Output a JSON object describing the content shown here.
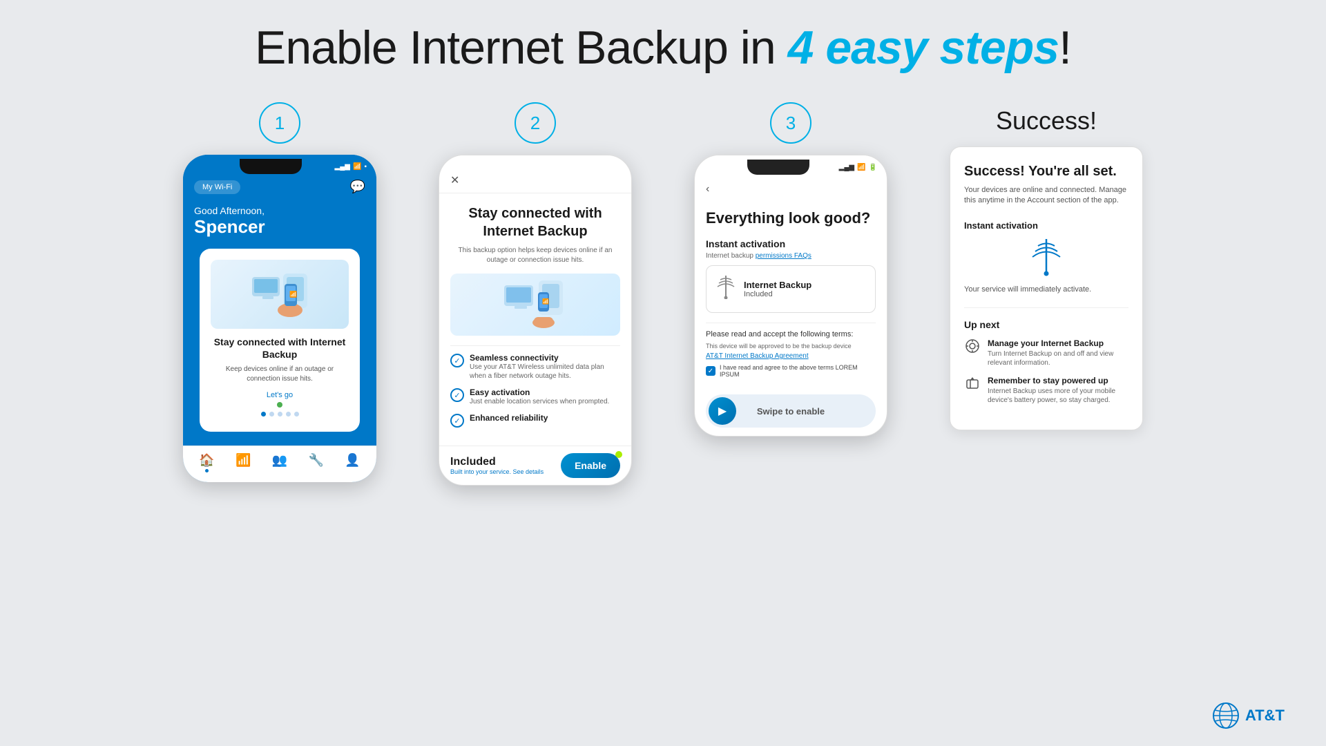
{
  "page": {
    "title_prefix": "Enable Internet Backup in ",
    "title_highlight": "4 easy steps",
    "title_suffix": "!"
  },
  "step1": {
    "number": "1",
    "status_signal": "▂▄▆",
    "status_wifi": "WiFi",
    "status_battery": "🔋",
    "wifi_pill": "My Wi-Fi",
    "greeting": "Good Afternoon,",
    "name": "Spencer",
    "card_title": "Stay connected with Internet Backup",
    "card_desc": "Keep devices online if an outage or connection issue hits.",
    "lets_go": "Let's go",
    "nav_items": [
      "home",
      "wifi",
      "people",
      "tools",
      "person"
    ]
  },
  "step2": {
    "number": "2",
    "title": "Stay connected with Internet Backup",
    "subtitle": "This backup option helps keep devices online if an outage or connection issue hits.",
    "feature1_title": "Seamless connectivity",
    "feature1_desc": "Use your AT&T Wireless unlimited data plan when a fiber network outage hits.",
    "feature2_title": "Easy activation",
    "feature2_desc": "Just enable location services when prompted.",
    "feature3_title": "Enhanced reliability",
    "included_label": "Included",
    "included_sub": "Built into your service. See details",
    "enable_btn": "Enable"
  },
  "step3": {
    "number": "3",
    "title": "Everything look good?",
    "activation_label": "Instant activation",
    "activation_sub": "Internet backup permissions FAQs",
    "backup_title": "Internet Backup",
    "backup_included": "Included",
    "terms_label": "Please read and accept the following terms:",
    "terms_desc": "This device will be approved to be the backup device",
    "terms_link": "AT&T Internet Backup Agreement",
    "terms_agree": "I have read and agree to the above terms LOREM IPSUM",
    "swipe_label": "Swipe to enable"
  },
  "success": {
    "label": "Success!",
    "title": "Success! You're all set.",
    "desc": "Your devices are online and connected. Manage this anytime in the Account section of the app.",
    "activation_label": "Instant activation",
    "activation_desc": "Your service will immediately activate.",
    "up_next_label": "Up next",
    "item1_title": "Manage your Internet Backup",
    "item1_desc": "Turn Internet Backup on and off and view relevant information.",
    "item2_title": "Remember to stay powered up",
    "item2_desc": "Internet Backup uses more of your mobile device's battery power, so stay charged."
  },
  "att": {
    "logo_text": "AT&T"
  }
}
